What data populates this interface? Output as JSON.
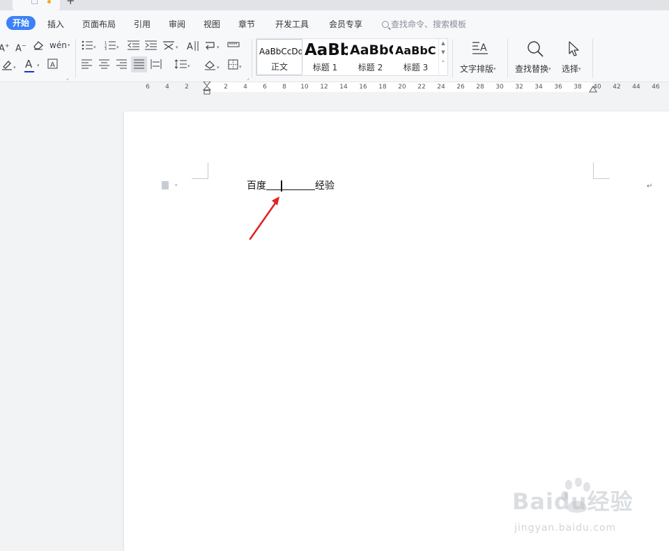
{
  "menubar": {
    "tabs": [
      "开始",
      "插入",
      "页面布局",
      "引用",
      "审阅",
      "视图",
      "章节",
      "开发工具",
      "会员专享"
    ],
    "search_placeholder": "查找命令、搜索模板"
  },
  "ribbon": {
    "styles": [
      {
        "sample": "AaBbCcDd",
        "name": "正文"
      },
      {
        "sample": "AaBb",
        "name": "标题 1"
      },
      {
        "sample": "AaBbC",
        "name": "标题 2"
      },
      {
        "sample": "AaBbC",
        "name": "标题 3"
      }
    ],
    "text_layout": "文字排版",
    "find_replace": "查找替换",
    "select": "选择",
    "font_color": "#1f2fc8"
  },
  "ruler": {
    "left_numbers": [
      "6",
      "4",
      "2"
    ],
    "right_numbers": [
      "2",
      "4",
      "6",
      "8",
      "10",
      "12",
      "14",
      "16",
      "18",
      "20",
      "22",
      "24",
      "26",
      "28",
      "30",
      "32",
      "34",
      "36",
      "38",
      "40",
      "42",
      "44",
      "46"
    ]
  },
  "document": {
    "before": "百度",
    "after": "经验"
  },
  "watermark": {
    "logo": "Baidu经验",
    "url": "jingyan.baidu.com"
  },
  "annotation": {
    "arrow_color": "#e02424"
  }
}
